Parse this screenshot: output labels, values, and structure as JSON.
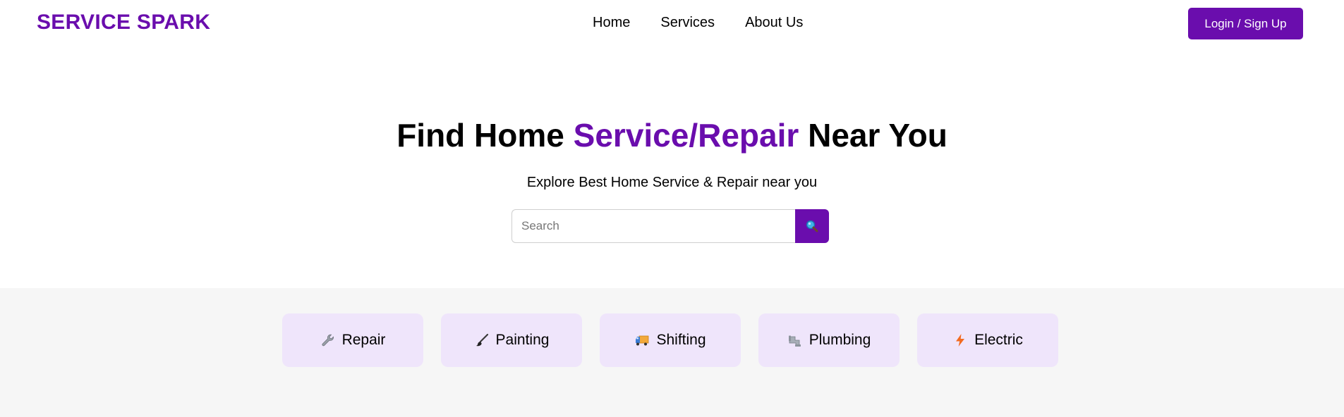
{
  "brand": {
    "name": "SERVICE SPARK",
    "color": "#6a0dad"
  },
  "nav": {
    "links": [
      {
        "label": "Home"
      },
      {
        "label": "Services"
      },
      {
        "label": "About Us"
      }
    ],
    "login_label": "Login / Sign Up"
  },
  "hero": {
    "title_part1": "Find Home ",
    "title_accent": "Service/Repair",
    "title_part2": " Near You",
    "subtitle": "Explore Best Home Service & Repair near you"
  },
  "search": {
    "placeholder": "Search",
    "value": "",
    "button_icon": "magnifier-icon"
  },
  "categories": [
    {
      "label": "Repair",
      "icon": "wrench-icon"
    },
    {
      "label": "Painting",
      "icon": "paintbrush-icon"
    },
    {
      "label": "Shifting",
      "icon": "truck-icon"
    },
    {
      "label": "Plumbing",
      "icon": "pipe-icon"
    },
    {
      "label": "Electric",
      "icon": "lightning-icon"
    }
  ]
}
